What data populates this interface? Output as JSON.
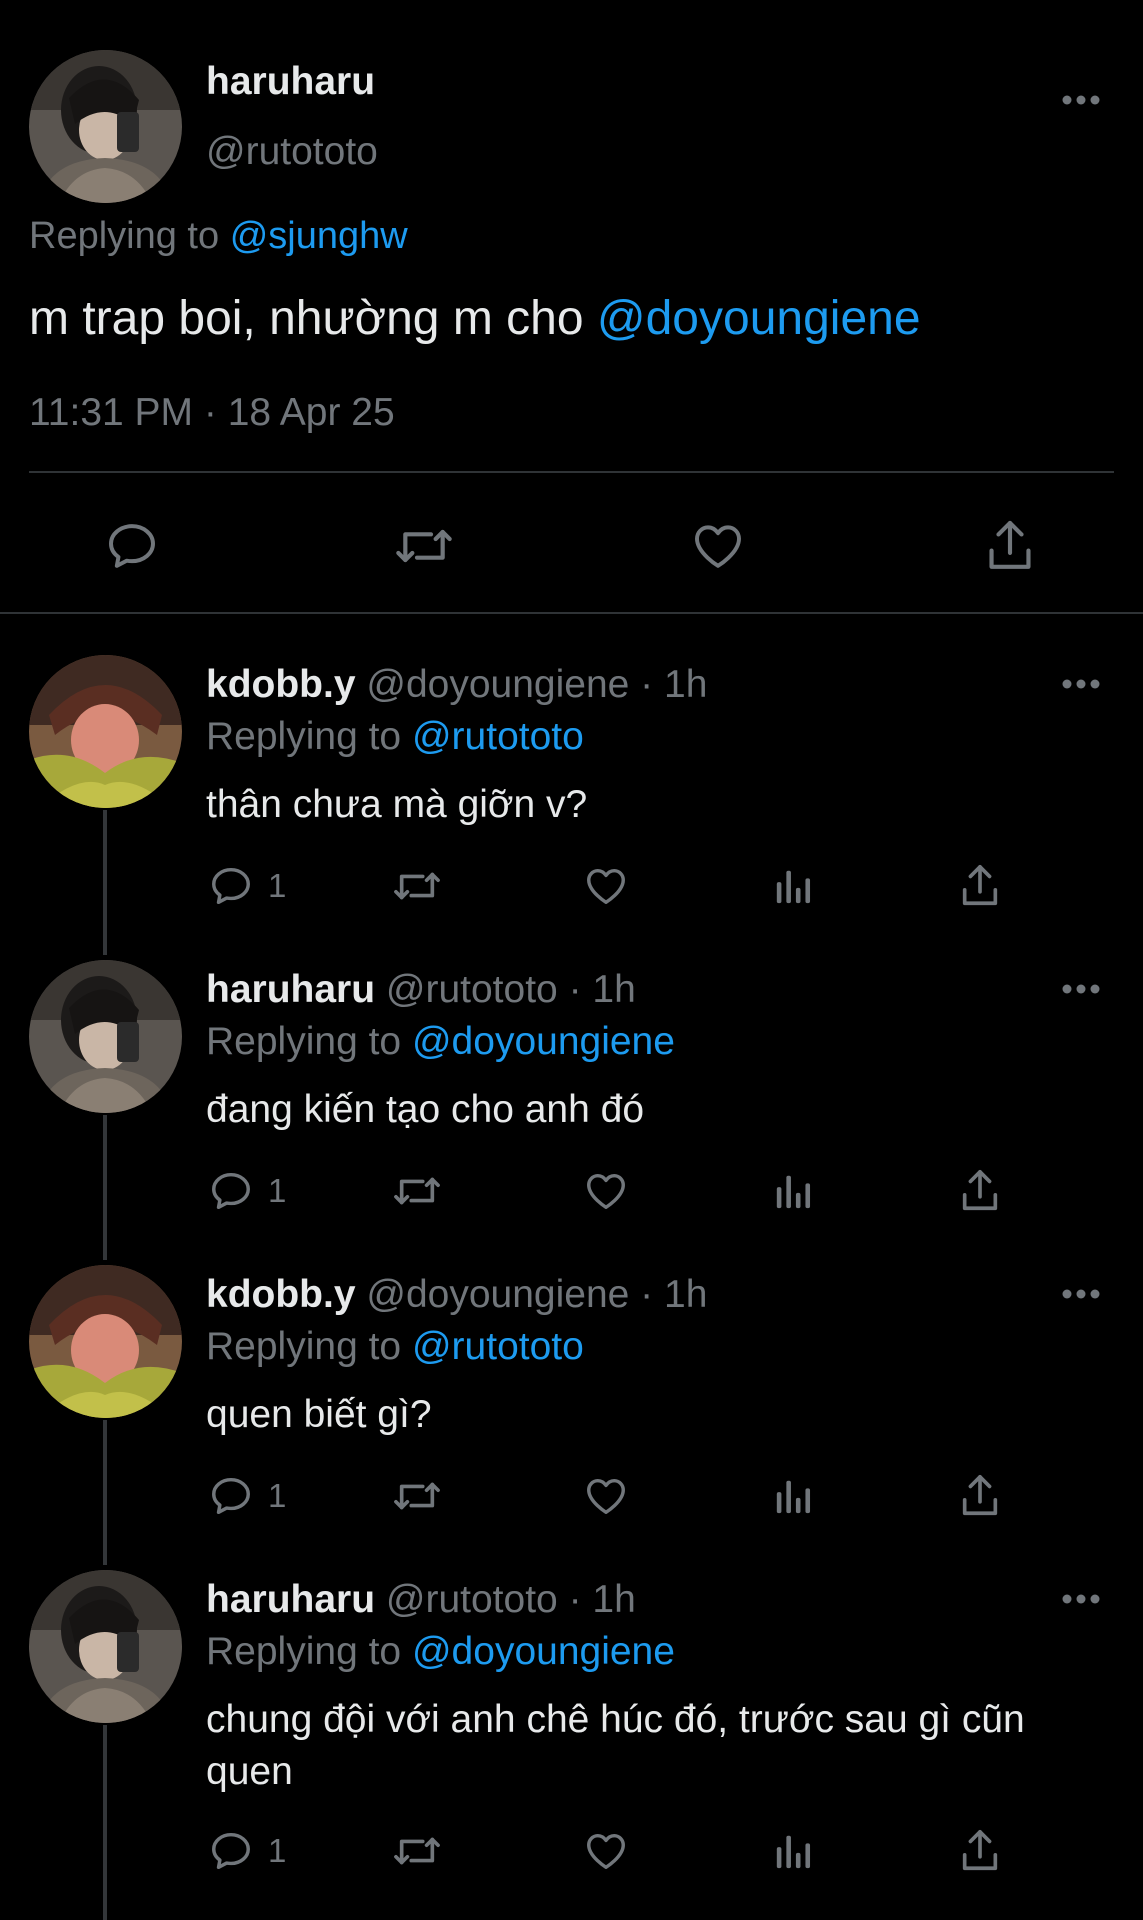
{
  "main_tweet": {
    "name": "haruharu",
    "handle": "@rutototo",
    "replying_prefix": "Replying to",
    "replying_to": "@sjunghw",
    "text": "m trap boi, nhường m cho ",
    "text_mention": "@doyoungiene",
    "timestamp": "11:31 PM · 18 Apr 25",
    "avatar_icon": "avatar-photo"
  },
  "replies": [
    {
      "name": "kdobb.y",
      "handle": "@doyoungiene",
      "dot": "·",
      "time": "1h",
      "replying_prefix": "Replying to",
      "replying_to": "@rutototo",
      "text": "thân chưa mà giỡn v?",
      "reply_count": "1"
    },
    {
      "name": "haruharu",
      "handle": "@rutototo",
      "dot": "·",
      "time": "1h",
      "replying_prefix": "Replying to",
      "replying_to": "@doyoungiene",
      "text": "đang kiến tạo cho anh đó",
      "reply_count": "1"
    },
    {
      "name": "kdobb.y",
      "handle": "@doyoungiene",
      "dot": "·",
      "time": "1h",
      "replying_prefix": "Replying to",
      "replying_to": "@rutototo",
      "text": "quen biết gì?",
      "reply_count": "1"
    },
    {
      "name": "haruharu",
      "handle": "@rutototo",
      "dot": "·",
      "time": "1h",
      "replying_prefix": "Replying to",
      "replying_to": "@doyoungiene",
      "text": "chung đội với anh chê húc đó, trước sau gì cũn quen",
      "reply_count": "1"
    }
  ],
  "icons": {
    "more": "more-horizontal-icon",
    "reply": "reply-bubble-icon",
    "retweet": "retweet-icon",
    "like": "heart-icon",
    "views": "views-bar-chart-icon",
    "share": "share-upload-icon"
  },
  "colors": {
    "background": "#000000",
    "text": "#e7e9ea",
    "secondary": "#71767b",
    "accent": "#1d9bf0",
    "divider": "#2f3336"
  }
}
